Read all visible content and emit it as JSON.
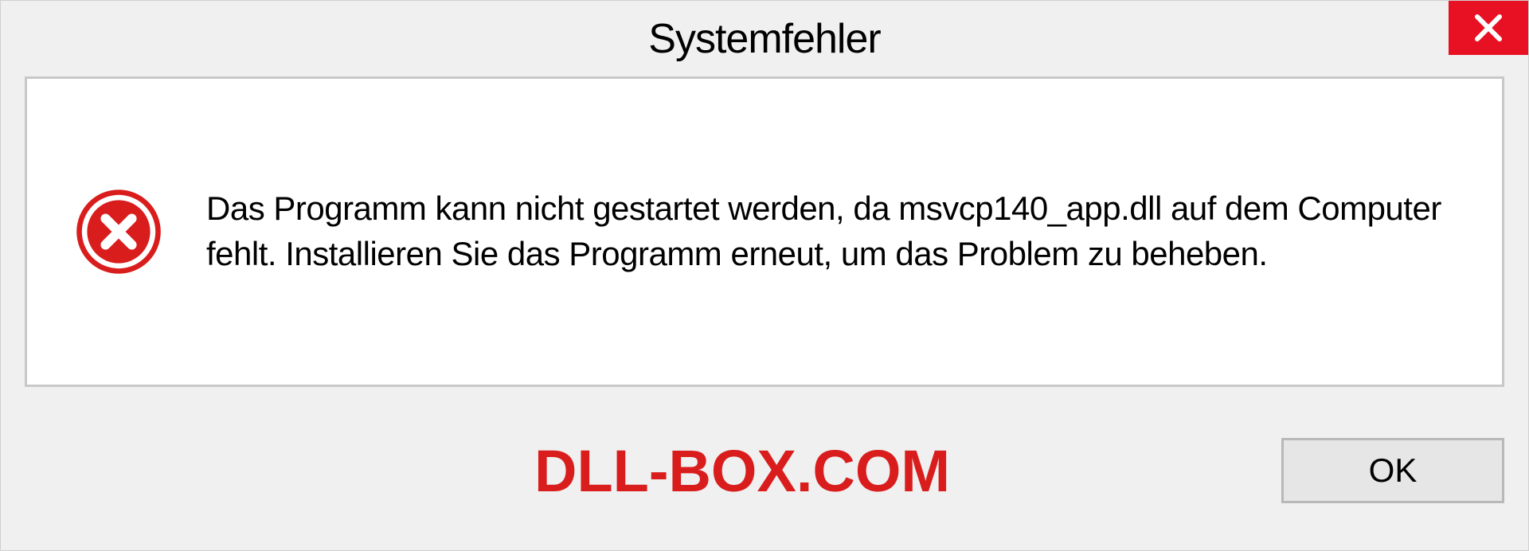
{
  "dialog": {
    "title": "Systemfehler",
    "message": "Das Programm kann nicht gestartet werden, da msvcp140_app.dll auf dem Computer fehlt. Installieren Sie das Programm erneut, um das Problem zu beheben.",
    "ok_label": "OK"
  },
  "watermark": "DLL-BOX.COM",
  "colors": {
    "close_bg": "#e81123",
    "error_icon": "#d91d1d",
    "watermark": "#d91d1d"
  }
}
